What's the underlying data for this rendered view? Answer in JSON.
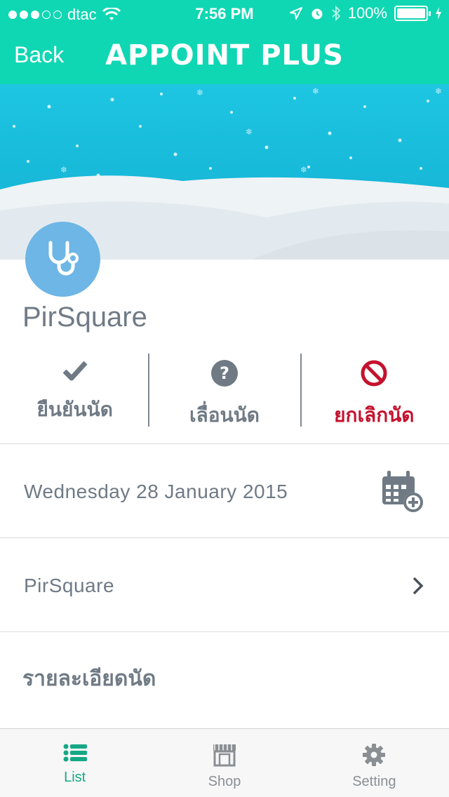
{
  "status_bar": {
    "carrier": "dtac",
    "time": "7:56 PM",
    "battery": "100%"
  },
  "nav": {
    "back_label": "Back",
    "title": "APPOINT PLUS"
  },
  "shop": {
    "name": "PirSquare"
  },
  "actions": {
    "confirm_label": "ยืนยันนัด",
    "postpone_label": "เลื่อนนัด",
    "cancel_label": "ยกเลิกนัด"
  },
  "appointment": {
    "date": "Wednesday 28 January 2015",
    "shop_link": "PirSquare",
    "details_heading": "รายละเอียดนัด"
  },
  "tabbar": {
    "tabs": [
      {
        "label": "List",
        "icon": "list-icon",
        "active": true
      },
      {
        "label": "Shop",
        "icon": "shop-icon",
        "active": false
      },
      {
        "label": "Setting",
        "icon": "gear-icon",
        "active": false
      }
    ]
  },
  "colors": {
    "brand": "#0fd7b3",
    "cancel": "#c4122e",
    "active_tab": "#16a885"
  }
}
